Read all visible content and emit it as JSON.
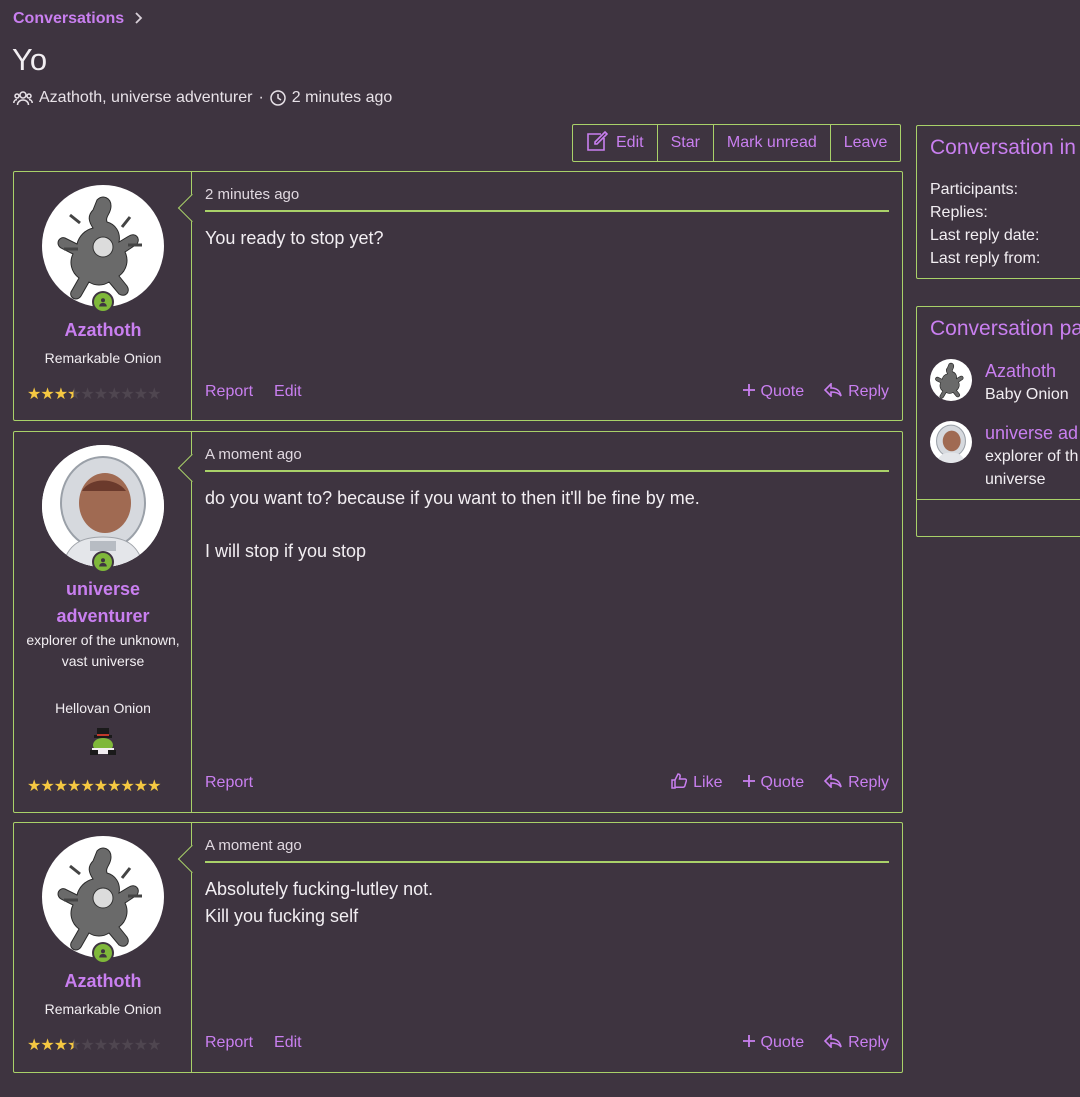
{
  "breadcrumb": {
    "label": "Conversations"
  },
  "title": "Yo",
  "meta": {
    "participants": "Azathoth, universe adventurer",
    "separator": "·",
    "time": "2 minutes ago"
  },
  "actions": {
    "edit": "Edit",
    "star": "Star",
    "mark_unread": "Mark unread",
    "leave": "Leave"
  },
  "messages": [
    {
      "date": "2 minutes ago",
      "author": "Azathoth",
      "user_title": "Remarkable Onion",
      "rating": 3.5,
      "lines": [
        "You ready to stop yet?"
      ],
      "footer_left": [
        "Report",
        "Edit"
      ],
      "footer_right": {
        "quote": "Quote",
        "reply": "Reply"
      }
    },
    {
      "date": "A moment ago",
      "author": "universe adventurer",
      "user_custom_title": "explorer of the unknown, vast universe",
      "user_title": "Hellovan Onion",
      "rating": 10,
      "lines": [
        "do you want to? because if you want to then it'll be fine by me.",
        "I will stop if you stop"
      ],
      "footer_left": [
        "Report"
      ],
      "footer_right": {
        "like": "Like",
        "quote": "Quote",
        "reply": "Reply"
      }
    },
    {
      "date": "A moment ago",
      "author": "Azathoth",
      "user_title": "Remarkable Onion",
      "rating": 3.5,
      "lines": [
        "Absolutely fucking-lutley not.",
        "Kill you fucking self"
      ],
      "footer_left": [
        "Report",
        "Edit"
      ],
      "footer_right": {
        "quote": "Quote",
        "reply": "Reply"
      }
    }
  ],
  "sidebar": {
    "info": {
      "heading": "Conversation in",
      "rows": [
        "Participants:",
        "Replies:",
        "Last reply date:",
        "Last reply from:"
      ]
    },
    "participants": {
      "heading": "Conversation pa",
      "list": [
        {
          "name": "Azathoth",
          "title": "Baby Onion"
        },
        {
          "name": "universe ad",
          "title": "explorer of th universe"
        }
      ]
    }
  },
  "colors": {
    "background": "#3e3440",
    "accent": "#c97ff0",
    "border": "#a9d169",
    "star": "#f5c842",
    "online": "#7fb83a"
  }
}
